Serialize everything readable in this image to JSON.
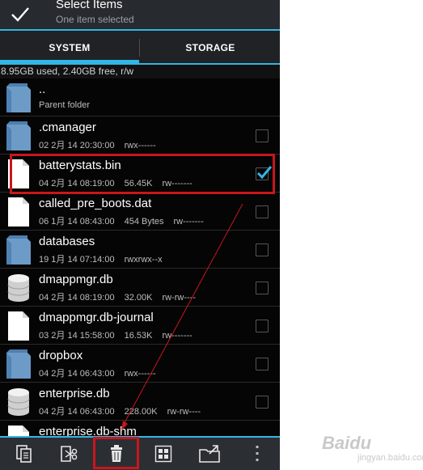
{
  "action_bar": {
    "title": "Select Items",
    "subtitle": "One item selected"
  },
  "tabs": [
    {
      "label": "SYSTEM",
      "active": true
    },
    {
      "label": "STORAGE",
      "active": false
    }
  ],
  "storage_info": "8.95GB used, 2.40GB free, r/w",
  "files": [
    {
      "name": "..",
      "meta": [
        "Parent folder"
      ],
      "icon": "folder-icon",
      "checkbox": false,
      "checked": false
    },
    {
      "name": ".cmanager",
      "meta": [
        "02 2月 14 20:30:00",
        "rwx------"
      ],
      "icon": "folder-icon",
      "checkbox": true,
      "checked": false
    },
    {
      "name": "batterystats.bin",
      "meta": [
        "04 2月 14 08:19:00",
        "56.45K",
        "rw-------"
      ],
      "icon": "file-icon",
      "checkbox": true,
      "checked": true
    },
    {
      "name": "called_pre_boots.dat",
      "meta": [
        "06 1月 14 08:43:00",
        "454 Bytes",
        "rw-------"
      ],
      "icon": "file-icon",
      "checkbox": true,
      "checked": false
    },
    {
      "name": "databases",
      "meta": [
        "19 1月 14 07:14:00",
        "rwxrwx--x"
      ],
      "icon": "folder-icon",
      "checkbox": true,
      "checked": false
    },
    {
      "name": "dmappmgr.db",
      "meta": [
        "04 2月 14 08:19:00",
        "32.00K",
        "rw-rw----"
      ],
      "icon": "database-icon",
      "checkbox": true,
      "checked": false
    },
    {
      "name": "dmappmgr.db-journal",
      "meta": [
        "03 2月 14 15:58:00",
        "16.53K",
        "rw-------"
      ],
      "icon": "file-icon",
      "checkbox": true,
      "checked": false
    },
    {
      "name": "dropbox",
      "meta": [
        "04 2月 14 06:43:00",
        "rwx------"
      ],
      "icon": "folder-icon",
      "checkbox": true,
      "checked": false
    },
    {
      "name": "enterprise.db",
      "meta": [
        "04 2月 14 06:43:00",
        "228.00K",
        "rw-rw----"
      ],
      "icon": "database-icon",
      "checkbox": true,
      "checked": false
    },
    {
      "name": "enterprise.db-shm",
      "meta": [],
      "icon": "file-icon",
      "checkbox": false,
      "checked": false
    }
  ],
  "toolbar": [
    {
      "name": "copy-icon"
    },
    {
      "name": "cut-icon"
    },
    {
      "name": "delete-icon"
    },
    {
      "name": "select-all-icon"
    },
    {
      "name": "move-icon"
    },
    {
      "name": "overflow-menu-icon"
    }
  ],
  "watermark": {
    "text": "Baidu",
    "sub": "jingyan.baidu.com"
  },
  "colors": {
    "accent": "#33b5e5",
    "annotation": "#c8161d",
    "folder": "#6c9bc8"
  }
}
